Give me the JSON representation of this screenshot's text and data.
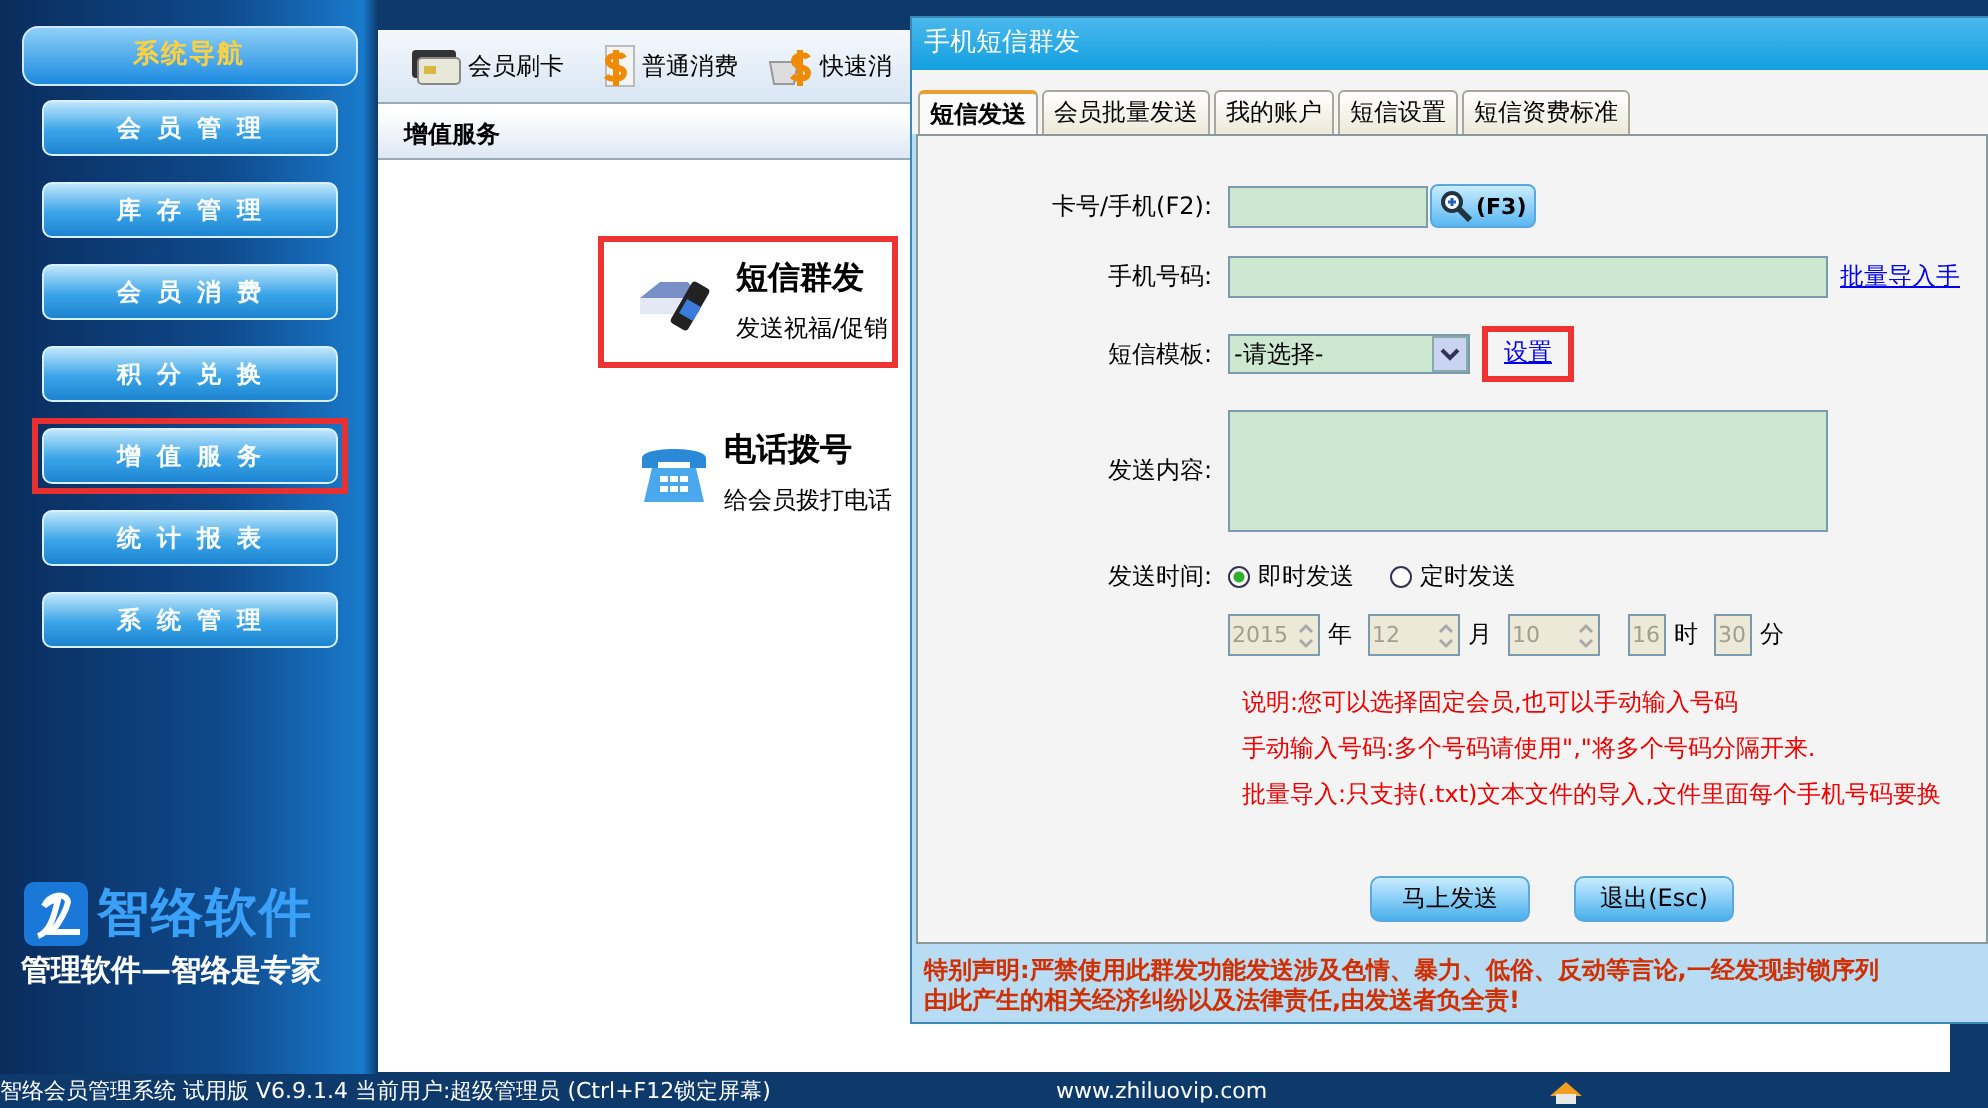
{
  "sidebar": {
    "title": "系统导航",
    "items": [
      {
        "label": "会员管理",
        "highlighted": false
      },
      {
        "label": "库存管理",
        "highlighted": false
      },
      {
        "label": "会员消费",
        "highlighted": false
      },
      {
        "label": "积分兑换",
        "highlighted": false
      },
      {
        "label": "增值服务",
        "highlighted": true
      },
      {
        "label": "统计报表",
        "highlighted": false
      },
      {
        "label": "系统管理",
        "highlighted": false
      }
    ],
    "logo": {
      "name": "智络软件",
      "slogan": "管理软件—智络是专家"
    }
  },
  "toolbar": {
    "items": [
      {
        "label": "会员刷卡",
        "kind": "card"
      },
      {
        "label": "普通消费",
        "kind": "dollar"
      },
      {
        "label": "快速消",
        "kind": "basket"
      }
    ]
  },
  "section": {
    "title": "增值服务",
    "services": [
      {
        "kind": "sms",
        "title": "短信群发",
        "subtitle": "发送祝福/促销",
        "highlighted": true
      },
      {
        "kind": "phone",
        "title": "电话拨号",
        "subtitle": "给会员拨打电话",
        "highlighted": false
      }
    ]
  },
  "dialog": {
    "title": "手机短信群发",
    "tabs": [
      {
        "label": "短信发送",
        "selected": true
      },
      {
        "label": "会员批量发送",
        "selected": false
      },
      {
        "label": "我的账户",
        "selected": false
      },
      {
        "label": "短信设置",
        "selected": false
      },
      {
        "label": "短信资费标准",
        "selected": false
      }
    ],
    "card_label": "卡号/手机(F2):",
    "search_button": "(F3)",
    "phone_label": "手机号码:",
    "import_link": "批量导入手",
    "template_label": "短信模板:",
    "template_value": "-请选择-",
    "template_link": "设置",
    "template_link_highlighted": true,
    "content_label": "发送内容:",
    "time_label": "发送时间:",
    "time_options": [
      {
        "label": "即时发送",
        "selected": true
      },
      {
        "label": "定时发送",
        "selected": false
      }
    ],
    "schedule_disabled": true,
    "schedule": [
      {
        "kind": "spin",
        "value": "2015",
        "unit": "年"
      },
      {
        "kind": "spin",
        "value": "12",
        "unit": "月"
      },
      {
        "kind": "spin",
        "value": "10"
      },
      {
        "kind": "plain",
        "value": "16",
        "unit": "时"
      },
      {
        "kind": "plain",
        "value": "30",
        "unit": "分"
      }
    ],
    "notes": [
      "说明:您可以选择固定会员,也可以手动输入号码",
      "手动输入号码:多个号码请使用\",\"将多个号码分隔开来.",
      "批量导入:只支持(.txt)文本文件的导入,文件里面每个手机号码要换"
    ],
    "buttons": [
      "马上发送",
      "退出(Esc)"
    ],
    "disclaimer": [
      "特别声明:严禁使用此群发功能发送涉及色情、暴力、低俗、反动等言论,一经发现封锁序列",
      "由此产生的相关经济纠纷以及法律责任,由发送者负全责!"
    ]
  },
  "status_bar": {
    "text": "智络会员管理系统 试用版 V6.9.1.4 当前用户:超级管理员 (Ctrl+F12锁定屏幕)",
    "website": "www.zhiluovip.com"
  }
}
